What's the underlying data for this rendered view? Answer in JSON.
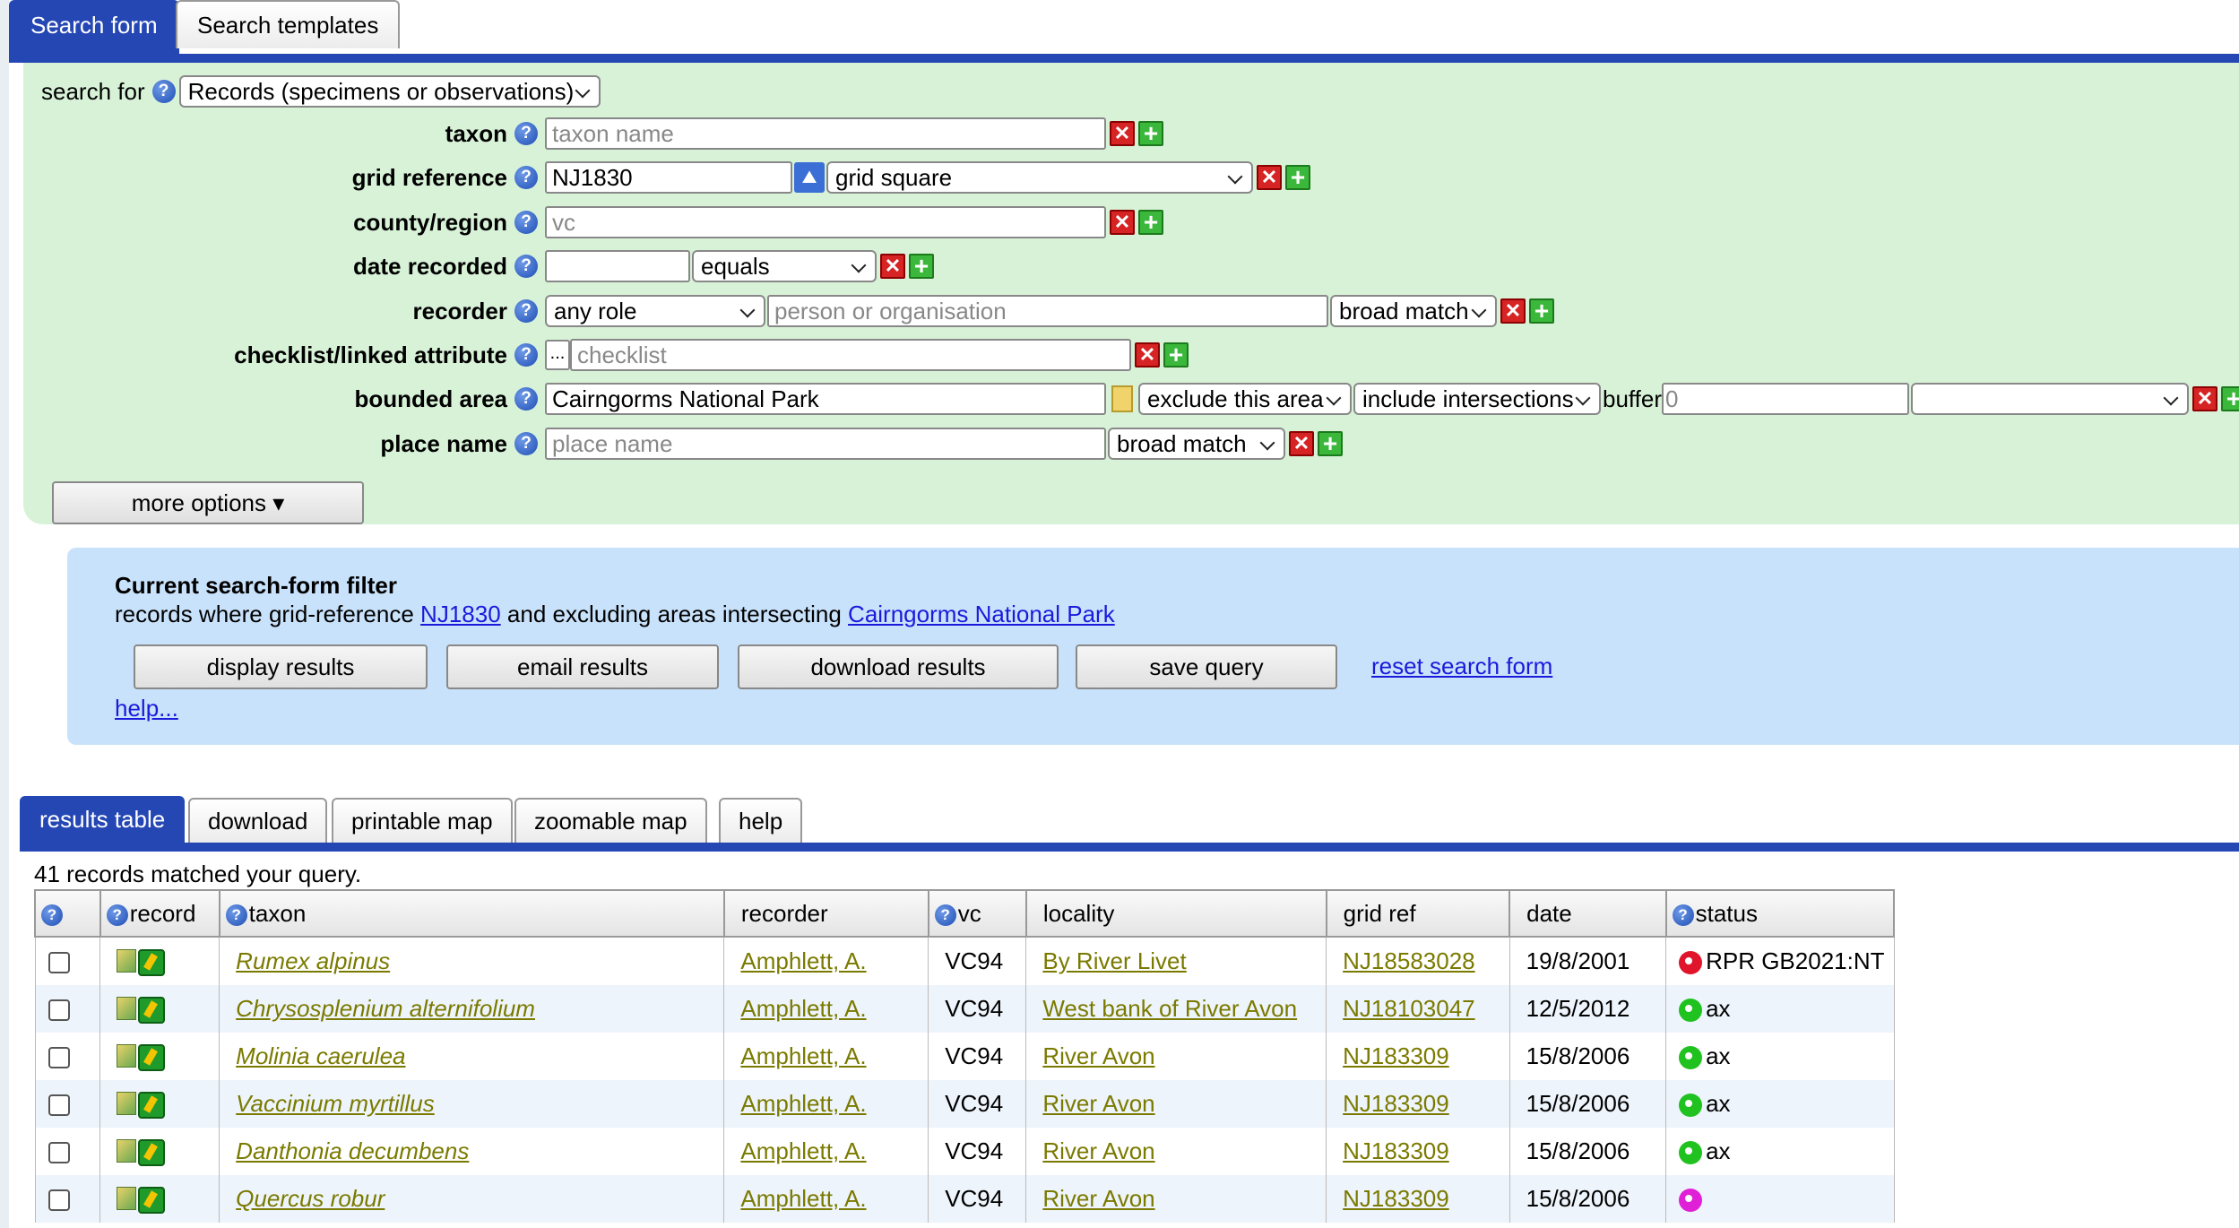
{
  "top_tabs": [
    "Search form",
    "Search templates"
  ],
  "form": {
    "search_for_label": "search for",
    "search_for_value": "Records (specimens or observations)",
    "taxon": {
      "label": "taxon",
      "placeholder": "taxon name"
    },
    "grid_reference": {
      "label": "grid reference",
      "value": "NJ1830",
      "mode": "grid square"
    },
    "county_region": {
      "label": "county/region",
      "placeholder": "vc"
    },
    "date_recorded": {
      "label": "date recorded",
      "value": "",
      "operator": "equals"
    },
    "recorder": {
      "label": "recorder",
      "role": "any role",
      "placeholder": "person or organisation",
      "match": "broad match"
    },
    "checklist": {
      "label": "checklist/linked attribute",
      "button": "...",
      "placeholder": "checklist"
    },
    "bounded_area": {
      "label": "bounded area",
      "value": "Cairngorms National Park",
      "exclude": "exclude this area",
      "intersect": "include intersections",
      "buffer_label": "buffer",
      "buffer_value": "0",
      "buffer_unit": ""
    },
    "place_name": {
      "label": "place name",
      "placeholder": "place name",
      "match": "broad match"
    },
    "more_options": "more options ▾"
  },
  "filter": {
    "title": "Current search-form filter",
    "desc_prefix": "records where grid-reference",
    "grid_link": "NJ1830",
    "desc_middle": "and excluding areas intersecting",
    "area_link": "Cairngorms National Park",
    "buttons": [
      "display results",
      "email results",
      "download results",
      "save query"
    ],
    "reset": "reset search form",
    "help": "help..."
  },
  "result_tabs": [
    "results table",
    "download",
    "printable map",
    "zoomable map",
    "help"
  ],
  "matched_text": "41 records matched your query.",
  "table": {
    "headers": [
      "",
      "record",
      "taxon",
      "recorder",
      "vc",
      "locality",
      "grid ref",
      "date",
      "status"
    ],
    "rows": [
      {
        "taxon": "Rumex alpinus",
        "recorder": "Amphlett, A.",
        "vc": "VC94",
        "locality": "By River Livet",
        "gridref": "NJ18583028",
        "date": "19/8/2001",
        "status": "RPR GB2021:NT",
        "status_color": "#e0142b"
      },
      {
        "taxon": "Chrysosplenium alternifolium",
        "recorder": "Amphlett, A.",
        "vc": "VC94",
        "locality": "West bank of River Avon",
        "gridref": "NJ18103047",
        "date": "12/5/2012",
        "status": "ax",
        "status_color": "#1fc21f"
      },
      {
        "taxon": "Molinia caerulea",
        "recorder": "Amphlett, A.",
        "vc": "VC94",
        "locality": "River Avon",
        "gridref": "NJ183309",
        "date": "15/8/2006",
        "status": "ax",
        "status_color": "#1fc21f"
      },
      {
        "taxon": "Vaccinium myrtillus",
        "recorder": "Amphlett, A.",
        "vc": "VC94",
        "locality": "River Avon",
        "gridref": "NJ183309",
        "date": "15/8/2006",
        "status": "ax",
        "status_color": "#1fc21f"
      },
      {
        "taxon": "Danthonia decumbens",
        "recorder": "Amphlett, A.",
        "vc": "VC94",
        "locality": "River Avon",
        "gridref": "NJ183309",
        "date": "15/8/2006",
        "status": "ax",
        "status_color": "#1fc21f"
      },
      {
        "taxon": "Quercus robur",
        "recorder": "Amphlett, A.",
        "vc": "VC94",
        "locality": "River Avon",
        "gridref": "NJ183309",
        "date": "15/8/2006",
        "status": "",
        "status_color": "#e020d6"
      }
    ]
  }
}
